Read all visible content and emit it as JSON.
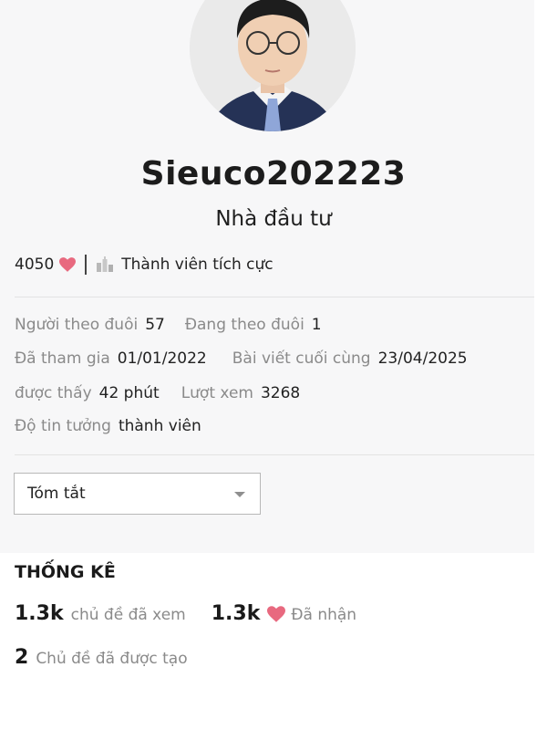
{
  "profile": {
    "username": "Sieuco202223",
    "title": "Nhà đầu tư",
    "reputation": "4050",
    "rank": "Thành viên tích cực"
  },
  "info": {
    "followers_label": "Người theo đuôi",
    "followers_value": "57",
    "following_label": "Đang theo đuôi",
    "following_value": "1",
    "joined_label": "Đã tham gia",
    "joined_value": "01/01/2022",
    "last_post_label": "Bài viết cuối cùng",
    "last_post_value": "23/04/2025",
    "seen_label": "được thấy",
    "seen_value": "42 phút",
    "views_label": "Lượt xem",
    "views_value": "3268",
    "trust_label": "Độ tin tưởng",
    "trust_value": "thành viên"
  },
  "dropdown": {
    "selected": "Tóm tắt"
  },
  "stats": {
    "heading": "THỐNG KÊ",
    "topics_viewed_value": "1.3k",
    "topics_viewed_label": "chủ đề đã xem",
    "likes_received_value": "1.3k",
    "likes_received_label": "Đã nhận",
    "topics_created_value": "2",
    "topics_created_label": "Chủ đề đã được tạo"
  },
  "icons": {
    "heart": "heart-icon",
    "badge": "badge-icon",
    "caret": "chevron-down-icon"
  },
  "colors": {
    "heart": "#e8697f",
    "muted_text": "#8a8a8a",
    "panel_bg": "#f7f7f8"
  }
}
